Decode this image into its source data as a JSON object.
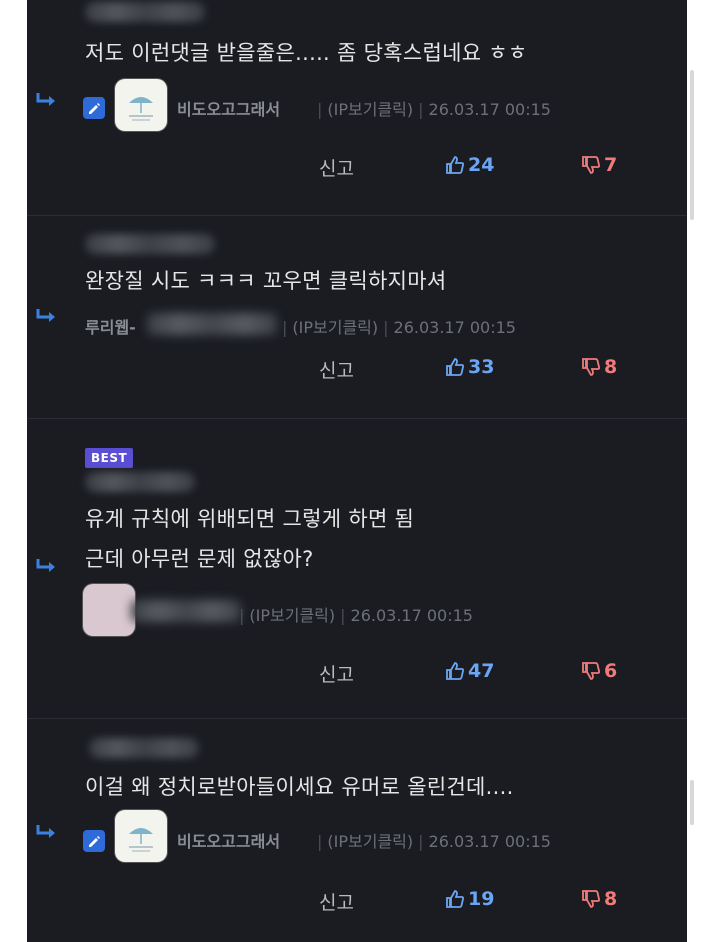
{
  "comments": [
    {
      "text": [
        "저도 이런댓글 받을줄은..... 좀 당혹스럽네요 ㅎㅎ"
      ],
      "nickname": "비도오고그래서",
      "ip_label": "(IP보기클릭)",
      "timestamp": "26.03.17 00:15",
      "report": "신고",
      "upvotes": "24",
      "downvotes": "7"
    },
    {
      "text": [
        "완장질 시도 ㅋㅋㅋ 꼬우면 클릭하지마셔"
      ],
      "nickname": "루리웹-",
      "ip_label": "(IP보기클릭)",
      "timestamp": "26.03.17 00:15",
      "report": "신고",
      "upvotes": "33",
      "downvotes": "8"
    },
    {
      "badge": "BEST",
      "text": [
        "유게 규칙에 위배되면 그렇게 하면 됨",
        "근데 아무런 문제 없잖아?"
      ],
      "ip_label": "(IP보기클릭)",
      "timestamp": "26.03.17 00:15",
      "report": "신고",
      "upvotes": "47",
      "downvotes": "6"
    },
    {
      "text": [
        "이걸 왜 정치로받아들이세요 유머로 올린건데...."
      ],
      "nickname": "비도오고그래서",
      "ip_label": "(IP보기클릭)",
      "timestamp": "26.03.17 00:15",
      "report": "신고",
      "upvotes": "19",
      "downvotes": "8"
    }
  ],
  "colors": {
    "background": "#1a1c22",
    "upvote": "#6aa6f5",
    "downvote": "#f07b7b",
    "best_badge": "#5a4fd4",
    "reply_arrow": "#3b82e0"
  }
}
